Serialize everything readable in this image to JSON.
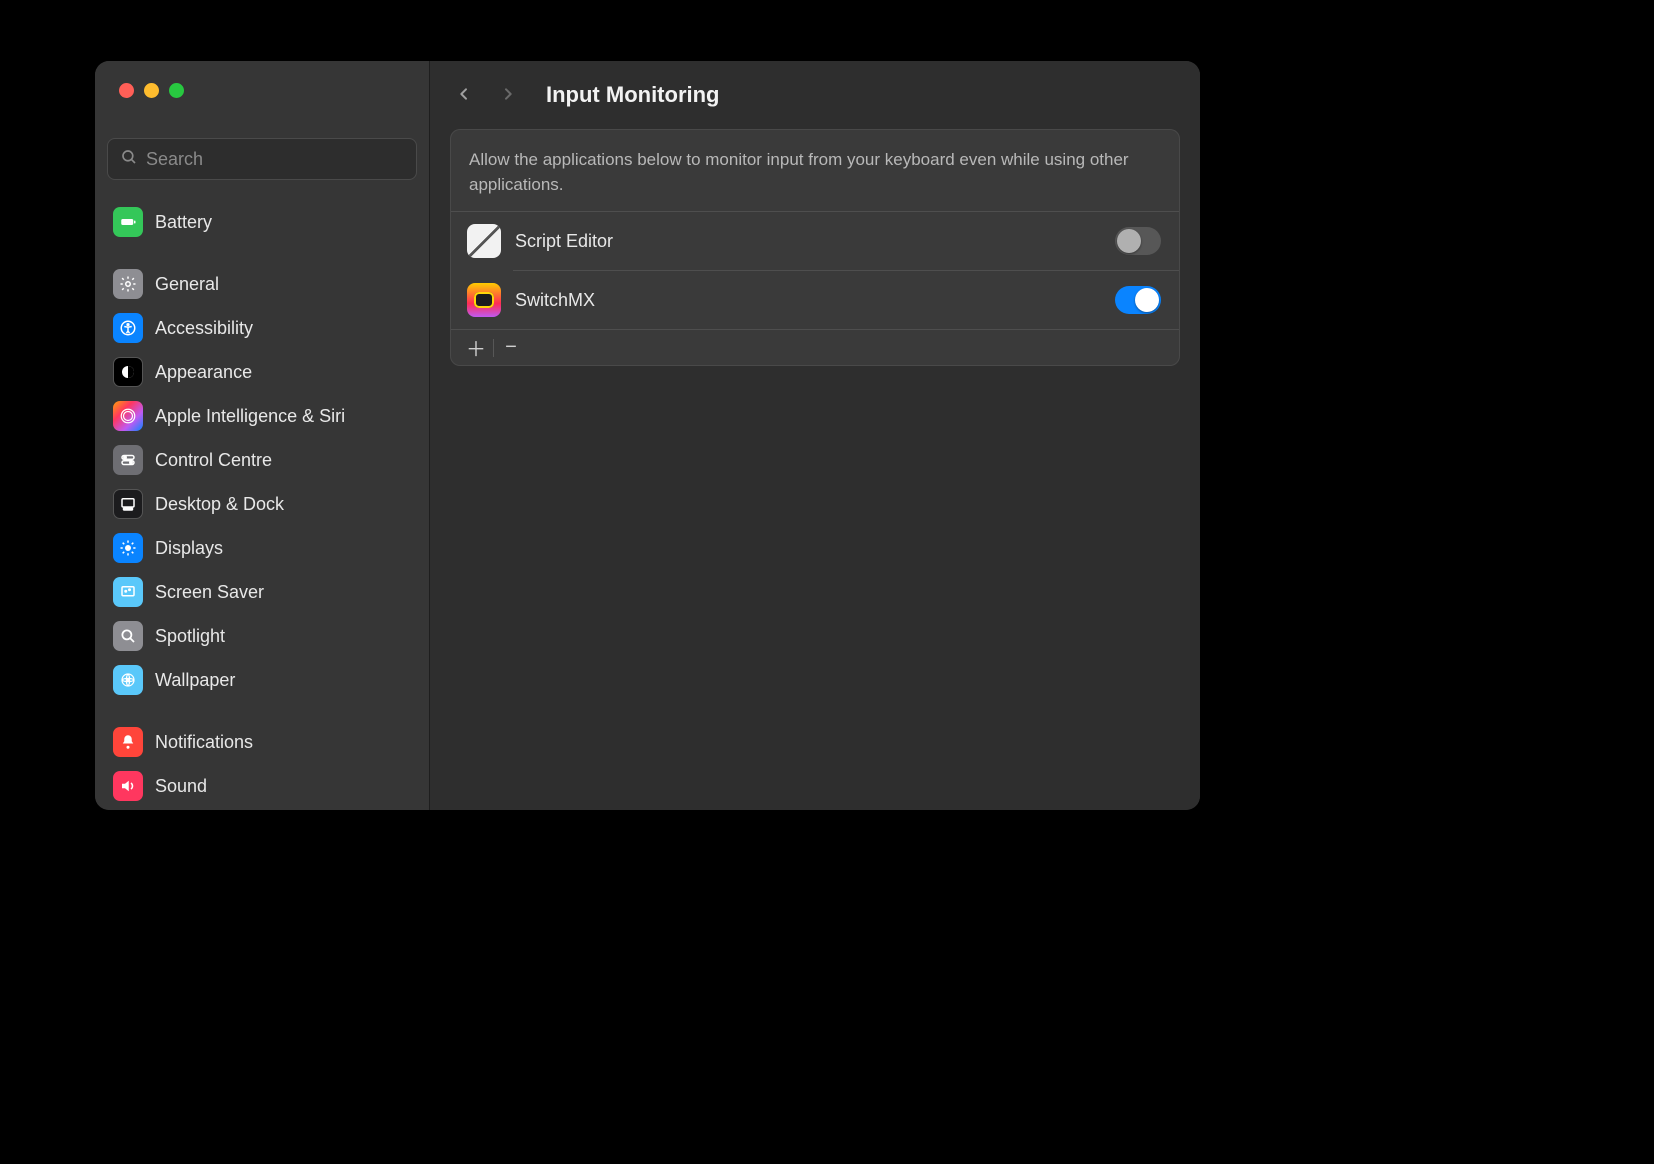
{
  "search": {
    "placeholder": "Search"
  },
  "sidebar": {
    "groups": [
      {
        "items": [
          {
            "id": "battery",
            "label": "Battery"
          }
        ]
      },
      {
        "items": [
          {
            "id": "general",
            "label": "General"
          },
          {
            "id": "accessibility",
            "label": "Accessibility"
          },
          {
            "id": "appearance",
            "label": "Appearance"
          },
          {
            "id": "apple-intelligence-siri",
            "label": "Apple Intelligence & Siri"
          },
          {
            "id": "control-centre",
            "label": "Control Centre"
          },
          {
            "id": "desktop-dock",
            "label": "Desktop & Dock"
          },
          {
            "id": "displays",
            "label": "Displays"
          },
          {
            "id": "screen-saver",
            "label": "Screen Saver"
          },
          {
            "id": "spotlight",
            "label": "Spotlight"
          },
          {
            "id": "wallpaper",
            "label": "Wallpaper"
          }
        ]
      },
      {
        "items": [
          {
            "id": "notifications",
            "label": "Notifications"
          },
          {
            "id": "sound",
            "label": "Sound"
          }
        ]
      }
    ]
  },
  "header": {
    "title": "Input Monitoring"
  },
  "panel": {
    "description": "Allow the applications below to monitor input from your keyboard even while using other applications.",
    "apps": [
      {
        "id": "script-editor",
        "name": "Script Editor",
        "enabled": false
      },
      {
        "id": "switchmx",
        "name": "SwitchMX",
        "enabled": true
      }
    ]
  }
}
